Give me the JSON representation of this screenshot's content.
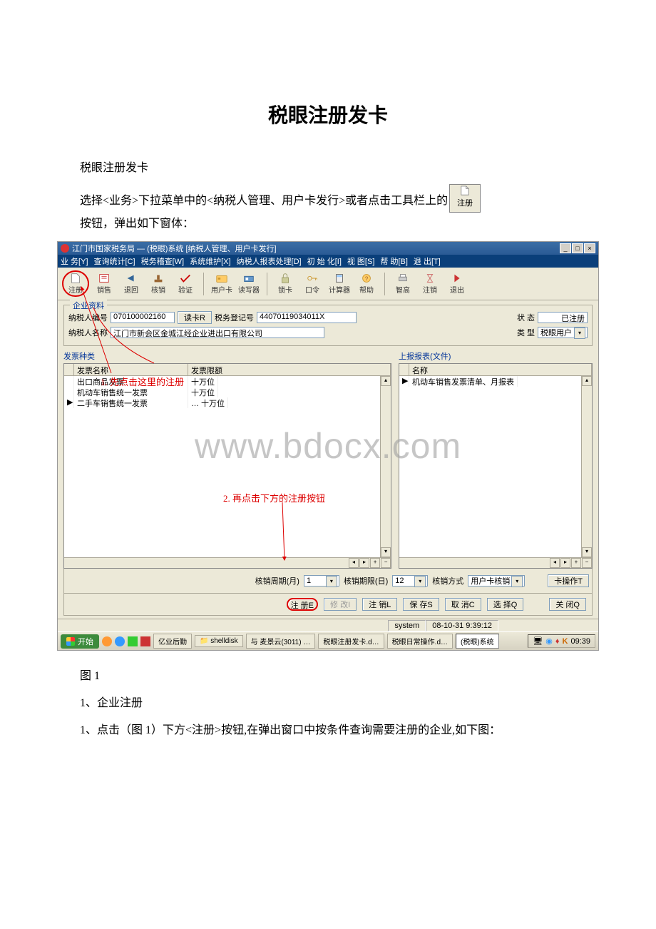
{
  "doc": {
    "title": "税眼注册发卡",
    "p1": "税眼注册发卡",
    "p2a": "选择<业务>下拉菜单中的<纳税人管理、用户卡发行>或者点击工具栏上的",
    "p2b": "按钮，弹出如下窗体：",
    "reg_icon_label": "注册",
    "fig_label": "图 1",
    "p3": "1、企业注册",
    "p4": "1、点击（图 1）下方<注册>按钮,在弹出窗口中按条件查询需要注册的企业,如下图："
  },
  "shot": {
    "title": "江门市国家税务局 — (税眼)系统  [纳税人管理、用户卡发行]",
    "winbtns": {
      "min": "_",
      "max": "□",
      "close": "×"
    },
    "menus": [
      "业 务[Y]",
      "查询统计[C]",
      "税务稽查[W]",
      "系统维护[X]",
      "纳税人报表处理[D]",
      "初 始 化[I]",
      "视 图[S]",
      "帮 助[B]",
      "退 出[T]"
    ],
    "toolbar": [
      {
        "label": "注册",
        "icon": "file"
      },
      {
        "label": "销售",
        "icon": "doc-red"
      },
      {
        "label": "退回",
        "icon": "back"
      },
      {
        "label": "核销",
        "icon": "stamp"
      },
      {
        "label": "验证",
        "icon": "check"
      },
      {
        "label": "用户卡",
        "icon": "card"
      },
      {
        "label": "读写器",
        "icon": "reader"
      },
      {
        "label": "锁卡",
        "icon": "lock"
      },
      {
        "label": "口令",
        "icon": "key"
      },
      {
        "label": "计算器",
        "icon": "calc"
      },
      {
        "label": "帮助",
        "icon": "help"
      },
      {
        "label": "智高",
        "icon": "print"
      },
      {
        "label": "注销",
        "icon": "hourglass"
      },
      {
        "label": "退出",
        "icon": "exit"
      }
    ],
    "group_title": "企业资料",
    "taxpayer_id_lbl": "纳税人编号",
    "taxpayer_id": "070100002160",
    "read_card": "读卡R",
    "tax_reg_lbl": "税务登记号",
    "tax_reg": "44070119034011X",
    "status_lbl": "状 态",
    "status_val": "已注册",
    "taxpayer_name_lbl": "纳税人名称",
    "taxpayer_name": "江门市新会区金城江经企业进出口有限公司",
    "type_lbl": "类 型",
    "type_val": "税眼用户",
    "left_title": "发票种类",
    "left_cols": {
      "name": "发票名称",
      "limit": "发票限额"
    },
    "left_rows": [
      {
        "name": "出口商品发票",
        "limit": "十万位"
      },
      {
        "name": "机动车销售统一发票",
        "limit": "十万位"
      },
      {
        "name": "二手车销售统一发票",
        "limit": "… 十万位",
        "marker": "▶"
      }
    ],
    "right_title": "上报报表(文件)",
    "right_cols": {
      "name": "名称"
    },
    "right_rows": [
      {
        "name": "机动车销售发票清单、月报表",
        "marker": "▶"
      }
    ],
    "annot1": "1. 先点击这里的注册",
    "annot2": "2. 再点击下方的注册按钮",
    "watermark": "www.bdocx.com",
    "period_lbl": "核销周期(月)",
    "period_val": "1",
    "deadline_lbl": "核销期限(日)",
    "deadline_val": "12",
    "method_lbl": "核销方式",
    "method_val": "用户卡核销",
    "card_op_btn": "卡操作T",
    "buttons": {
      "reg": "注 册E",
      "mod": "修 改I",
      "logout": "注 销L",
      "save": "保 存S",
      "cancel": "取 消C",
      "select": "选 择Q",
      "close": "关 闭Q"
    },
    "status_user": "system",
    "status_time": "08-10-31 9:39:12",
    "taskbar": {
      "start": "开始",
      "items": [
        "亿业后勤",
        "shelldisk",
        "与 麦景云(3011) …",
        "税眼注册发卡.d…",
        "税眼日常操作.d…",
        "(税眼)系统"
      ],
      "tray_time": "09:39"
    }
  }
}
